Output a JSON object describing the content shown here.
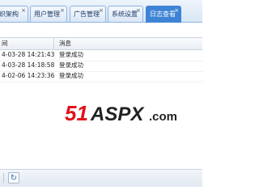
{
  "tabs": [
    {
      "label": "织架构",
      "close": "×",
      "active": false
    },
    {
      "label": "用户管理",
      "close": "×",
      "active": false
    },
    {
      "label": "广告管理",
      "close": "×",
      "active": false
    },
    {
      "label": "系统设置",
      "close": "×",
      "active": false
    },
    {
      "label": "日志查看",
      "close": "×",
      "active": true
    }
  ],
  "grid": {
    "columns": [
      "间",
      "消息"
    ],
    "rows": [
      {
        "time": "4-03-28 14:21:43",
        "message": "登录成功"
      },
      {
        "time": "4-03-28 14:18:58",
        "message": "登录成功"
      },
      {
        "time": "4-02-06 14:23:36",
        "message": "登录成功"
      }
    ]
  },
  "watermark": {
    "brand": "51",
    "name": "ASPX",
    "suffix": ".com"
  },
  "pager": {
    "refresh_icon": "↻"
  },
  "colors": {
    "active_tab": "#3e84d6",
    "brand_red": "#e3101b",
    "brand_dark": "#222222"
  }
}
